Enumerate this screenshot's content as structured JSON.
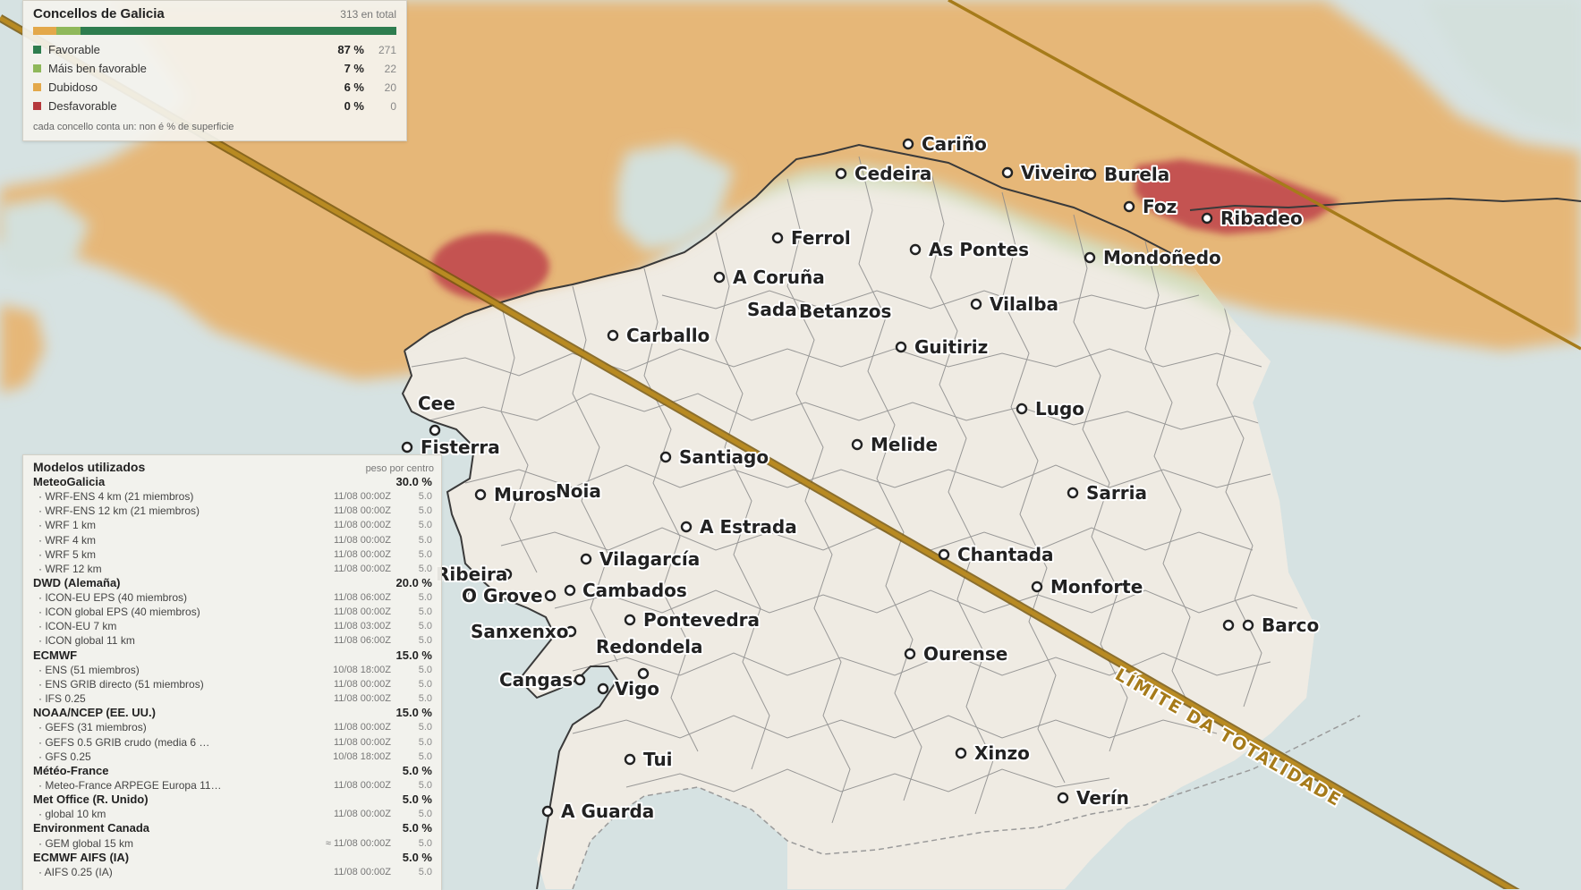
{
  "summary": {
    "title": "Concellos de Galicia",
    "total": "313 en total",
    "categories": [
      {
        "label": "Favorable",
        "pct": "87 %",
        "count": "271",
        "color": "#2e7d4f",
        "fraction": 0.87
      },
      {
        "label": "Máis ben favorable",
        "pct": "7 %",
        "count": "22",
        "color": "#8fb85a",
        "fraction": 0.07
      },
      {
        "label": "Dubidoso",
        "pct": "6 %",
        "count": "20",
        "color": "#e3a84a",
        "fraction": 0.06
      },
      {
        "label": "Desfavorable",
        "pct": "0 %",
        "count": "0",
        "color": "#b5383c",
        "fraction": 0.0
      }
    ],
    "note": "cada concello conta un: non é % de superficie"
  },
  "models": {
    "title": "Modelos utilizados",
    "subtitle": "peso por centro",
    "groups": [
      {
        "name": "MeteoGalicia",
        "weight": "30.0 %",
        "items": [
          {
            "name": "· WRF-ENS 4 km (21 miembros)",
            "time": "11/08 00:00Z",
            "w": "5.0"
          },
          {
            "name": "· WRF-ENS 12 km (21 miembros)",
            "time": "11/08 00:00Z",
            "w": "5.0"
          },
          {
            "name": "· WRF 1 km",
            "time": "11/08 00:00Z",
            "w": "5.0"
          },
          {
            "name": "· WRF 4 km",
            "time": "11/08 00:00Z",
            "w": "5.0"
          },
          {
            "name": "· WRF 5 km",
            "time": "11/08 00:00Z",
            "w": "5.0"
          },
          {
            "name": "· WRF 12 km",
            "time": "11/08 00:00Z",
            "w": "5.0"
          }
        ]
      },
      {
        "name": "DWD (Alemaña)",
        "weight": "20.0 %",
        "items": [
          {
            "name": "· ICON-EU EPS (40 miembros)",
            "time": "11/08 06:00Z",
            "w": "5.0"
          },
          {
            "name": "· ICON global EPS (40 miembros)",
            "time": "11/08 00:00Z",
            "w": "5.0"
          },
          {
            "name": "· ICON-EU 7 km",
            "time": "11/08 03:00Z",
            "w": "5.0"
          },
          {
            "name": "· ICON global 11 km",
            "time": "11/08 06:00Z",
            "w": "5.0"
          }
        ]
      },
      {
        "name": "ECMWF",
        "weight": "15.0 %",
        "items": [
          {
            "name": "· ENS (51 miembros)",
            "time": "10/08 18:00Z",
            "w": "5.0"
          },
          {
            "name": "· ENS GRIB directo (51 miembros)",
            "time": "11/08 00:00Z",
            "w": "5.0"
          },
          {
            "name": "· IFS 0.25",
            "time": "11/08 00:00Z",
            "w": "5.0"
          }
        ]
      },
      {
        "name": "NOAA/NCEP (EE. UU.)",
        "weight": "15.0 %",
        "items": [
          {
            "name": "· GEFS (31 miembros)",
            "time": "11/08 00:00Z",
            "w": "5.0"
          },
          {
            "name": "· GEFS 0.5 GRIB crudo (media 6 …",
            "time": "11/08 00:00Z",
            "w": "5.0"
          },
          {
            "name": "· GFS 0.25",
            "time": "10/08 18:00Z",
            "w": "5.0"
          }
        ]
      },
      {
        "name": "Météo-France",
        "weight": "5.0 %",
        "items": [
          {
            "name": "· Meteo-France ARPEGE Europa 11…",
            "time": "11/08 00:00Z",
            "w": "5.0"
          }
        ]
      },
      {
        "name": "Met Office (R. Unido)",
        "weight": "5.0 %",
        "items": [
          {
            "name": "· global 10 km",
            "time": "11/08 00:00Z",
            "w": "5.0"
          }
        ]
      },
      {
        "name": "Environment Canada",
        "weight": "5.0 %",
        "items": [
          {
            "name": "· GEM global 15 km",
            "time": "≈ 11/08 00:00Z",
            "w": "5.0"
          }
        ]
      },
      {
        "name": "ECMWF AIFS (IA)",
        "weight": "5.0 %",
        "items": [
          {
            "name": "· AIFS 0.25 (IA)",
            "time": "11/08 00:00Z",
            "w": "5.0"
          }
        ]
      }
    ]
  },
  "map": {
    "totality_label": "LÍMITE DA TOTALIDADE",
    "colors": {
      "sea": "#d6e2e2",
      "land": "#efebe3",
      "dubidoso": "#e6b778",
      "favorable_halo": "#cfdcb9",
      "desfavorable": "#c0494c",
      "path": "#a67b1a",
      "coast": "#3a3a3a",
      "border": "#8a8a8a"
    },
    "cities": [
      "Cariño",
      "Cedeira",
      "Viveiro",
      "Burela",
      "Foz",
      "Ribadeo",
      "Ferrol",
      "As Pontes",
      "Mondoñedo",
      "A Coruña",
      "Sada",
      "Betanzos",
      "Vilalba",
      "Carballo",
      "Guitiriz",
      "Cee",
      "Fisterra",
      "Lugo",
      "Melide",
      "Santiago",
      "Muros",
      "Noia",
      "Sarria",
      "A Estrada",
      "Chantada",
      "Vilagarcía",
      "Ribeira",
      "Cambados",
      "O Grove",
      "Monforte",
      "Pontevedra",
      "Barco",
      "Sanxenxo",
      "Redondela",
      "Ourense",
      "Cangas",
      "Vigo",
      "Xinzo",
      "Tui",
      "Verín",
      "A Guarda"
    ]
  }
}
